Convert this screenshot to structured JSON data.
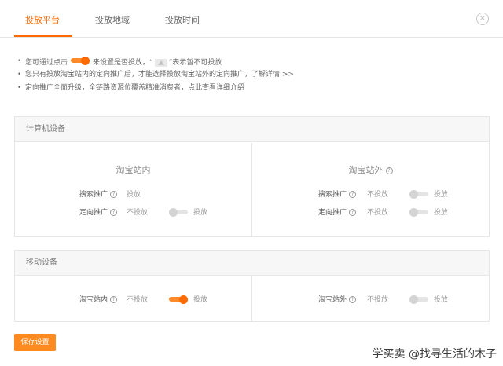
{
  "tabs": [
    {
      "label": "投放平台",
      "active": true
    },
    {
      "label": "投放地域"
    },
    {
      "label": "投放时间"
    }
  ],
  "close_label": "×",
  "notes": {
    "line1_prefix": "您可通过点击",
    "line1_middle": "来设置是否投放，“",
    "line1_suffix": "”表示暂不可投放",
    "line2": "您只有投放淘宝站内的定向推广后，才能选择投放淘宝站外的定向推广，了解详情 >>",
    "line3": "定向推广全面升级，全链路资源位覆盖精准消费者，点此查看详细介绍"
  },
  "computer": {
    "title": "计算机设备",
    "left_title": "淘宝站内",
    "right_title": "淘宝站外",
    "left_rows": [
      {
        "label": "搜索推广",
        "state": "投放"
      },
      {
        "label": "定向推广",
        "off": "不投放",
        "on": "投放",
        "toggle_on": false
      }
    ],
    "right_rows": [
      {
        "label": "搜索推广",
        "off": "不投放",
        "on": "投放",
        "toggle_on": false
      },
      {
        "label": "定向推广",
        "off": "不投放",
        "on": "投放",
        "toggle_on": false
      }
    ]
  },
  "mobile": {
    "title": "移动设备",
    "left_row": {
      "label": "淘宝站内",
      "off": "不投放",
      "on": "投放",
      "toggle_on": true
    },
    "right_row": {
      "label": "淘宝站外",
      "off": "不投放",
      "on": "投放",
      "toggle_on": false
    }
  },
  "save_label": "保存设置",
  "watermark": "学买卖 @找寻生活的木子",
  "colors": {
    "accent": "#ff6a00",
    "button": "#ff8a1f",
    "border": "#e6e6e6"
  }
}
